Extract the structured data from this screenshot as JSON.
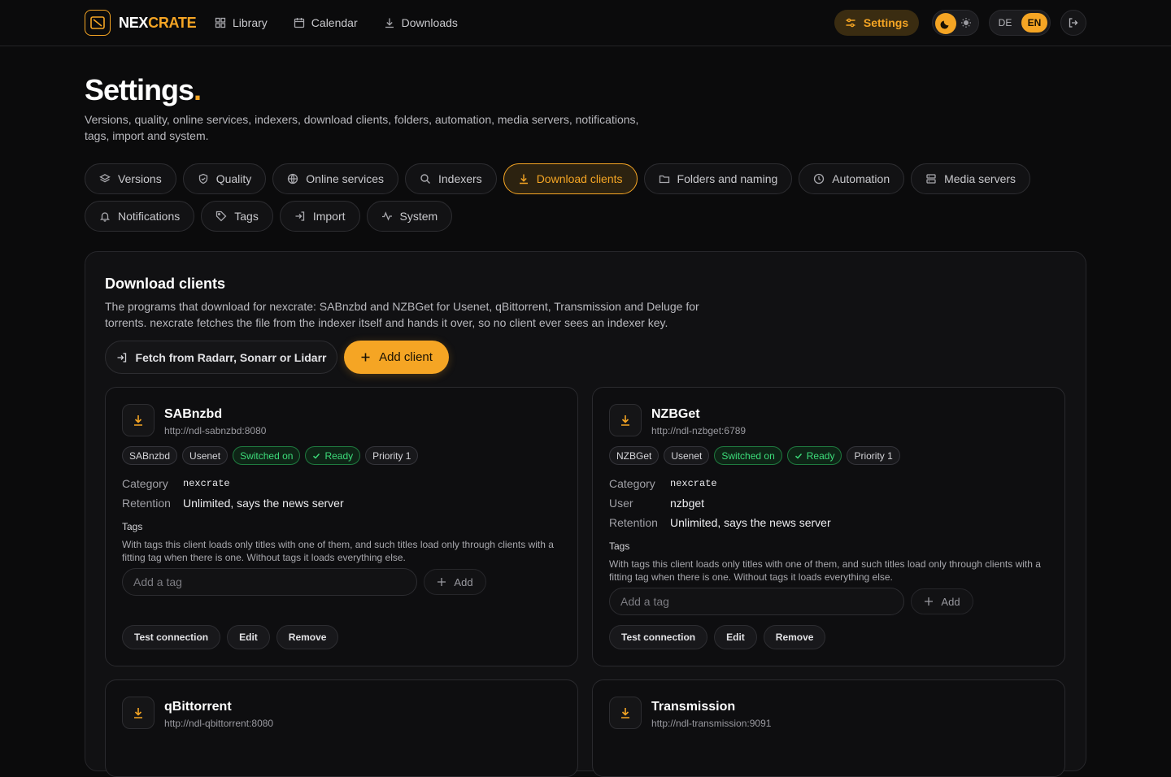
{
  "brand": {
    "part1": "NEX",
    "part2": "CRATE"
  },
  "nav": [
    {
      "label": "Library",
      "icon": "grid-icon"
    },
    {
      "label": "Calendar",
      "icon": "calendar-icon"
    },
    {
      "label": "Downloads",
      "icon": "download-icon"
    }
  ],
  "header": {
    "settings_label": "Settings",
    "lang_de": "DE",
    "lang_en": "EN",
    "active_lang": "EN",
    "theme": "dark"
  },
  "page": {
    "title": "Settings",
    "title_dot": ".",
    "subtitle": "Versions, quality, online services, indexers, download clients, folders, automation, media servers, notifications, tags, import and system."
  },
  "tabs": [
    {
      "label": "Versions",
      "icon": "layers-icon"
    },
    {
      "label": "Quality",
      "icon": "shield-icon"
    },
    {
      "label": "Online services",
      "icon": "globe-icon"
    },
    {
      "label": "Indexers",
      "icon": "search-icon"
    },
    {
      "label": "Download clients",
      "icon": "download-icon",
      "active": true
    },
    {
      "label": "Folders and naming",
      "icon": "folder-icon"
    },
    {
      "label": "Automation",
      "icon": "clock-icon"
    },
    {
      "label": "Media servers",
      "icon": "server-icon"
    },
    {
      "label": "Notifications",
      "icon": "bell-icon"
    },
    {
      "label": "Tags",
      "icon": "tag-icon"
    },
    {
      "label": "Import",
      "icon": "import-icon"
    },
    {
      "label": "System",
      "icon": "activity-icon"
    }
  ],
  "panel": {
    "title": "Download clients",
    "description": "The programs that download for nexcrate: SABnzbd and NZBGet for Usenet, qBittorrent, Transmission and Deluge for torrents. nexcrate fetches the file from the indexer itself and hands it over, so no client ever sees an indexer key.",
    "fetch_label": "Fetch from Radarr, Sonarr or Lidarr",
    "add_label": "Add client"
  },
  "clients": [
    {
      "name": "SABnzbd",
      "url": "http://ndl-sabnzbd:8080",
      "badges": {
        "type": "SABnzbd",
        "protocol": "Usenet",
        "enabled": "Switched on",
        "status": "Ready",
        "priority": "Priority 1"
      },
      "props": [
        {
          "key": "Category",
          "value": "nexcrate",
          "mono": true
        },
        {
          "key": "Retention",
          "value": "Unlimited, says the news server"
        }
      ],
      "tags_label": "Tags",
      "tags_help": "With tags this client loads only titles with one of them, and such titles load only through clients with a fitting tag when there is one. Without tags it loads everything else.",
      "tag_placeholder": "Add a tag",
      "tag_add": "Add",
      "actions": {
        "test": "Test connection",
        "edit": "Edit",
        "remove": "Remove"
      }
    },
    {
      "name": "NZBGet",
      "url": "http://ndl-nzbget:6789",
      "badges": {
        "type": "NZBGet",
        "protocol": "Usenet",
        "enabled": "Switched on",
        "status": "Ready",
        "priority": "Priority 1"
      },
      "props": [
        {
          "key": "Category",
          "value": "nexcrate",
          "mono": true
        },
        {
          "key": "User",
          "value": "nzbget"
        },
        {
          "key": "Retention",
          "value": "Unlimited, says the news server"
        }
      ],
      "tags_label": "Tags",
      "tags_help": "With tags this client loads only titles with one of them, and such titles load only through clients with a fitting tag when there is one. Without tags it loads everything else.",
      "tag_placeholder": "Add a tag",
      "tag_add": "Add",
      "actions": {
        "test": "Test connection",
        "edit": "Edit",
        "remove": "Remove"
      }
    },
    {
      "name": "qBittorrent",
      "url": "http://ndl-qbittorrent:8080"
    },
    {
      "name": "Transmission",
      "url": "http://ndl-transmission:9091"
    }
  ],
  "colors": {
    "accent": "#f5a524",
    "background": "#0b0b0c",
    "success": "#3ddc7a"
  }
}
